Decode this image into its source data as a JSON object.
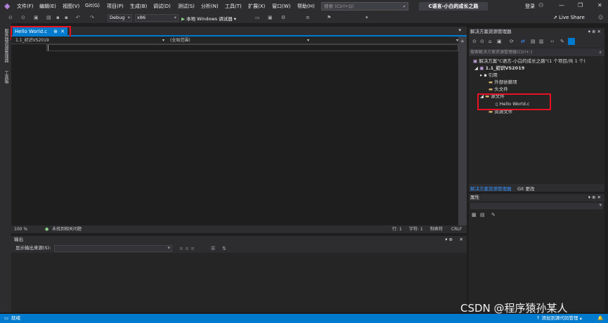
{
  "menu": [
    "文件(F)",
    "编辑(E)",
    "视图(V)",
    "Git(G)",
    "项目(P)",
    "生成(B)",
    "调试(D)",
    "测试(S)",
    "分析(N)",
    "工具(T)",
    "扩展(X)",
    "窗口(W)",
    "帮助(H)"
  ],
  "search": {
    "placeholder": "搜索 (Ctrl+Q)"
  },
  "app_title": "C语言-小白的成长之路",
  "login": "登录",
  "live_share": "Live Share",
  "toolbar": {
    "config": "Debug",
    "platform": "x86",
    "run_label": "本地 Windows 调试器"
  },
  "left_strip": {
    "item1": "服务器资源管理器",
    "item2": "工具箱"
  },
  "editor": {
    "tab_label": "Hello World.c",
    "nav_project": "1.1_初识VS2019",
    "nav_scope": "(全局范围)"
  },
  "status_line": {
    "zoom": "100 %",
    "issues": "未找到相关问题",
    "line": "行: 1",
    "char": "字符: 1",
    "tabs": "制表符",
    "eol": "CRLF"
  },
  "output": {
    "title": "输出",
    "source_label": "显示输出来源(S):"
  },
  "solution_explorer": {
    "title": "解决方案资源管理器",
    "search_placeholder": "搜索解决方案资源管理器(Ctrl+;)",
    "solution": "解决方案\"C语言-小白的成长之路\"(1 个项目/共 1 个)",
    "project": "1.1_初识VS2019",
    "nodes": {
      "refs": "引用",
      "external": "外部依赖项",
      "headers": "头文件",
      "sources": "源文件",
      "file": "Hello World.c",
      "resources": "资源文件"
    }
  },
  "bottom_tabs": {
    "solution": "解决方案资源管理器",
    "git": "Git 更改"
  },
  "properties": {
    "title": "属性"
  },
  "statusbar": {
    "ready": "就绪",
    "add_source": "添加到源代码管理"
  },
  "watermark": "CSDN @程序猿孙某人",
  "colors": {
    "accent": "#007acc",
    "highlight": "#e81123",
    "background": "#1e1e1e"
  }
}
